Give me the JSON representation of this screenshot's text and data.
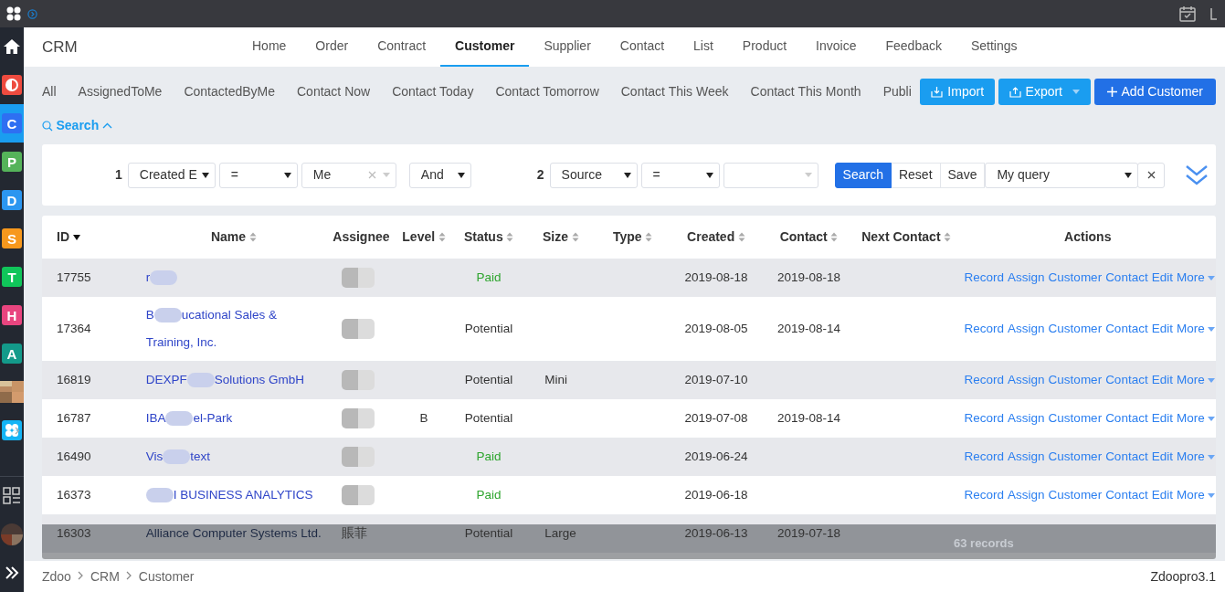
{
  "sidebar": {
    "apps": [
      {
        "kind": "half",
        "color": "#ee4b3f",
        "selected": false
      },
      {
        "kind": "letter",
        "letter": "C",
        "color": "#2e6ff2",
        "selected": true
      },
      {
        "kind": "letter",
        "letter": "P",
        "color": "#55b35a",
        "selected": false
      },
      {
        "kind": "letter",
        "letter": "D",
        "color": "#2b96f0",
        "selected": false
      },
      {
        "kind": "letter",
        "letter": "S",
        "color": "#f7981d",
        "selected": false
      },
      {
        "kind": "letter",
        "letter": "T",
        "color": "#10c55a",
        "selected": false
      },
      {
        "kind": "letter",
        "letter": "H",
        "color": "#e8457f",
        "selected": false
      },
      {
        "kind": "letter",
        "letter": "A",
        "color": "#139a8a",
        "selected": false
      },
      {
        "kind": "picture"
      },
      {
        "kind": "grid",
        "color": "#14b4f5",
        "selected": false
      }
    ]
  },
  "header": {
    "title": "CRM",
    "nav": [
      {
        "label": "Home",
        "selected": false
      },
      {
        "label": "Order",
        "selected": false
      },
      {
        "label": "Contract",
        "selected": false
      },
      {
        "label": "Customer",
        "selected": true
      },
      {
        "label": "Supplier",
        "selected": false
      },
      {
        "label": "Contact",
        "selected": false
      },
      {
        "label": "List",
        "selected": false
      },
      {
        "label": "Product",
        "selected": false
      },
      {
        "label": "Invoice",
        "selected": false
      },
      {
        "label": "Feedback",
        "selected": false
      },
      {
        "label": "Settings",
        "selected": false
      }
    ]
  },
  "filters": [
    "All",
    "AssignedToMe",
    "ContactedByMe",
    "Contact Now",
    "Contact Today",
    "Contact Tomorrow",
    "Contact This Week",
    "Contact This Month",
    "Publi"
  ],
  "actions": [
    {
      "label": "Import",
      "kind": "import"
    },
    {
      "label": "Export",
      "kind": "export"
    },
    {
      "label": "Add Customer",
      "kind": "add"
    }
  ],
  "search_toggle": {
    "label": "Search",
    "expanded": true
  },
  "search": {
    "conditions": [
      {
        "index": "1",
        "field": "Created E",
        "operator": "=",
        "value": "Me"
      },
      {
        "index": "2",
        "field": "Source",
        "operator": "="
      }
    ],
    "logic": "And",
    "buttons": [
      "Search",
      "Reset",
      "Save"
    ],
    "query": "My query"
  },
  "table": {
    "columns": [
      {
        "label": "ID",
        "sortable": true,
        "sorted": true
      },
      {
        "label": "Name",
        "sortable": true,
        "sorted": false
      },
      {
        "label": "Assignee",
        "sortable": false
      },
      {
        "label": "Level",
        "sortable": true,
        "sorted": false
      },
      {
        "label": "Status",
        "sortable": true,
        "sorted": false
      },
      {
        "label": "Size",
        "sortable": true,
        "sorted": false
      },
      {
        "label": "Type",
        "sortable": true,
        "sorted": false
      },
      {
        "label": "Created",
        "sortable": true,
        "sorted": false
      },
      {
        "label": "Contact",
        "sortable": true,
        "sorted": false
      },
      {
        "label": "Next Contact",
        "sortable": true,
        "sorted": false
      },
      {
        "label": "Actions",
        "sortable": false
      }
    ],
    "rows": [
      {
        "id": "17755",
        "name_start": "r",
        "level": "",
        "status": {
          "text": "Paid",
          "color": "#2ea52e"
        },
        "size": "",
        "created": "2019-08-18",
        "contact": "2019-08-18",
        "actions": [
          "Record",
          "Assign",
          "Customer",
          "Contact",
          "Edit",
          "More"
        ],
        "covered": false
      },
      {
        "id": "17364",
        "name_start": "B",
        "name_end": "ucational Sales &",
        "name_line2": "Training, Inc.",
        "level": "",
        "status": {
          "text": "Potential",
          "color": "#333333"
        },
        "size": "",
        "created": "2019-08-05",
        "contact": "2019-08-14",
        "actions": [
          "Record",
          "Assign",
          "Customer",
          "Contact",
          "Edit",
          "More"
        ],
        "covered": false
      },
      {
        "id": "16819",
        "name_start": "DEXPF",
        "name_end": "Solutions GmbH",
        "level": "",
        "status": {
          "text": "Potential",
          "color": "#333333"
        },
        "size": "Mini",
        "created": "2019-07-10",
        "contact": "",
        "actions": [
          "Record",
          "Assign",
          "Customer",
          "Contact",
          "Edit",
          "More"
        ],
        "covered": false
      },
      {
        "id": "16787",
        "name_start": "IBA",
        "name_end": "el-Park",
        "level": "B",
        "status": {
          "text": "Potential",
          "color": "#333333"
        },
        "size": "",
        "created": "2019-07-08",
        "contact": "2019-08-14",
        "actions": [
          "Record",
          "Assign",
          "Customer",
          "Contact",
          "Edit",
          "More"
        ],
        "covered": false
      },
      {
        "id": "16490",
        "name_start": "Vis",
        "name_end": "text",
        "level": "",
        "status": {
          "text": "Paid",
          "color": "#2ea52e"
        },
        "size": "",
        "created": "2019-06-24",
        "contact": "",
        "actions": [
          "Record",
          "Assign",
          "Customer",
          "Contact",
          "Edit",
          "More"
        ],
        "covered": false
      },
      {
        "id": "16373",
        "name_end": "I BUSINESS ANALYTICS",
        "level": "",
        "status": {
          "text": "Paid",
          "color": "#2ea52e"
        },
        "size": "",
        "created": "2019-06-18",
        "contact": "",
        "actions": [
          "Record",
          "Assign",
          "Customer",
          "Contact",
          "Edit",
          "More"
        ],
        "covered": false
      },
      {
        "id": "16303",
        "name_start": "Alliance Computer Systems Ltd.",
        "assignee": "賬菲",
        "level": "",
        "status": {
          "text": "Potential",
          "color": "#333333"
        },
        "size": "Large",
        "created": "2019-06-13",
        "contact": "2019-07-18",
        "covered": true
      }
    ]
  },
  "pager": {
    "records": "63 records"
  },
  "footer": {
    "breadcrumb": [
      "Zdoo",
      "CRM",
      "Customer"
    ],
    "version": "Zdoopro3.1"
  }
}
